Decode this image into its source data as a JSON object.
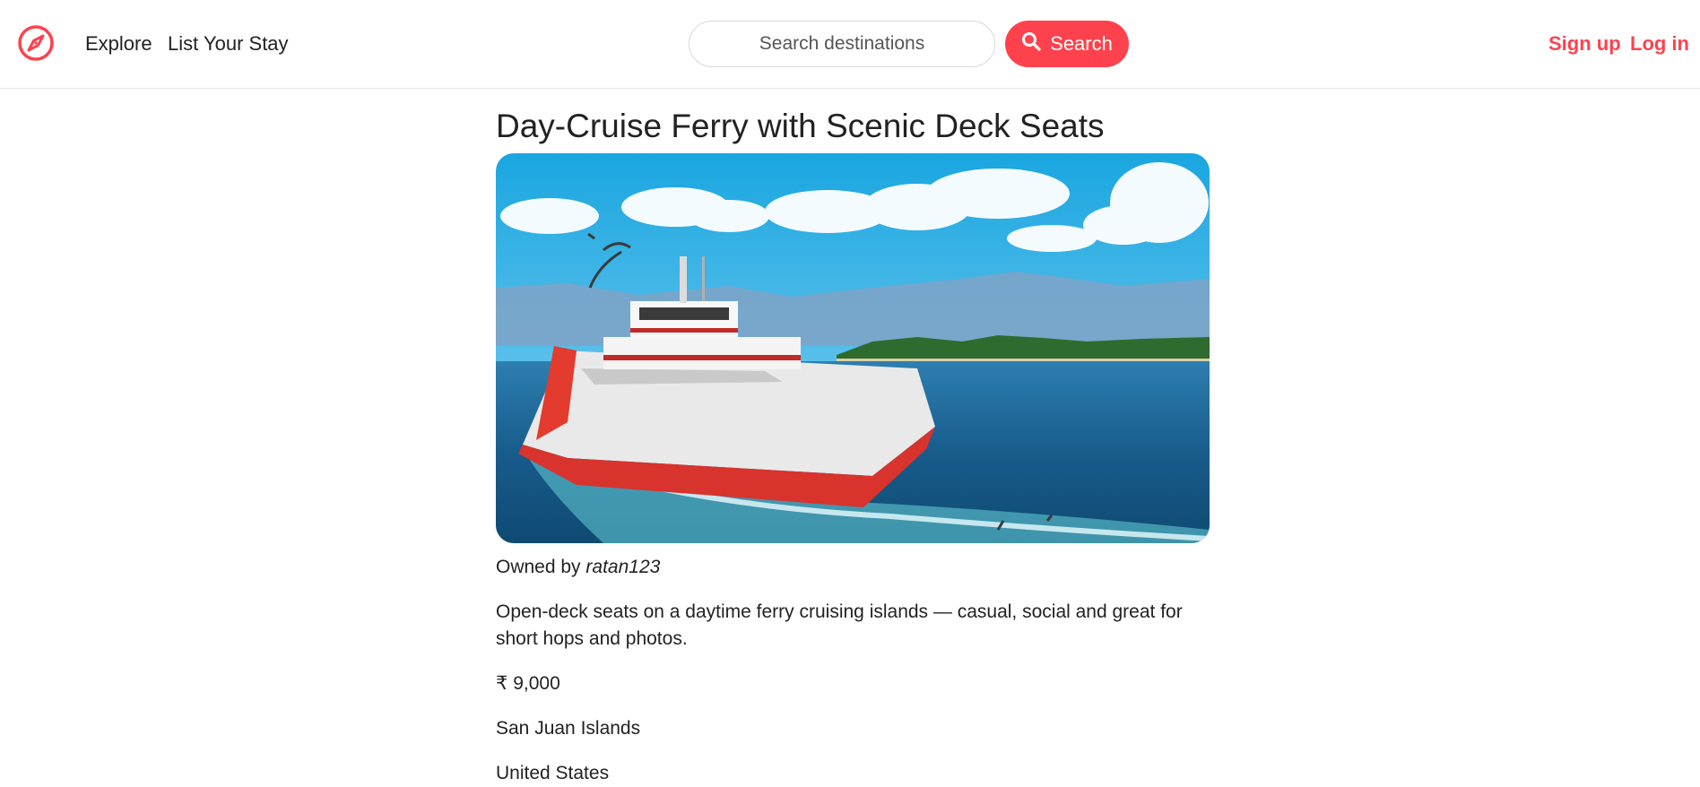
{
  "nav": {
    "explore_label": "Explore",
    "list_label": "List Your Stay"
  },
  "search": {
    "placeholder": "Search destinations",
    "button_label": "Search"
  },
  "auth": {
    "signup_label": "Sign up",
    "login_label": "Log in"
  },
  "listing": {
    "title": "Day-Cruise Ferry with Scenic Deck Seats",
    "owned_by_prefix": "Owned by",
    "owner": "ratan123",
    "description": "Open-deck seats on a daytime ferry cruising islands — casual, social and great for short hops and photos.",
    "price": "₹ 9,000",
    "location": "San Juan Islands",
    "country": "United States"
  },
  "colors": {
    "brand": "#fe424d",
    "text": "#222222"
  },
  "icons": {
    "logo": "compass-icon",
    "search": "search-icon"
  }
}
